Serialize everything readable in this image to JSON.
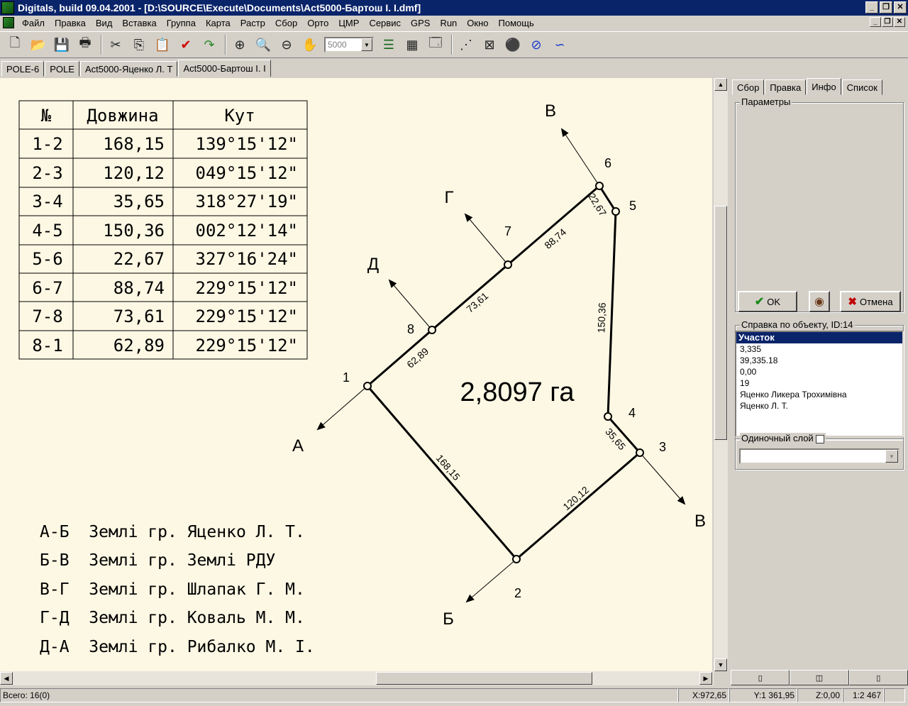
{
  "window": {
    "title": "Digitals, build 09.04.2001 - [D:\\SOURCE\\Execute\\Documents\\Act5000-Бартош І. І.dmf]",
    "min": "_",
    "max": "❐",
    "close": "✕"
  },
  "menu": [
    "Файл",
    "Правка",
    "Вид",
    "Вставка",
    "Группа",
    "Карта",
    "Растр",
    "Сбор",
    "Орто",
    "ЦМР",
    "Сервис",
    "GPS",
    "Run",
    "Окно",
    "Помощь"
  ],
  "toolbar": {
    "zoom_value": "5000",
    "icons": [
      "new-icon",
      "open-icon",
      "save-icon",
      "print-icon",
      "cut-icon",
      "copy-icon",
      "paste-icon",
      "check-icon",
      "redo-icon",
      "zoom-region-icon",
      "zoom-in-icon",
      "zoom-out-icon",
      "pan-hand-icon",
      "layers-icon",
      "table-icon",
      "properties-icon",
      "vectorize-icon",
      "clear-icon",
      "traffic-icon",
      "no-tools-icon",
      "curve-icon"
    ]
  },
  "doc_tabs": [
    "POLE-6",
    "POLE",
    "Act5000-Яценко Л. Т",
    "Act5000-Бартош І. І"
  ],
  "table": {
    "headers": [
      "№",
      "Довжина",
      "Кут"
    ],
    "rows": [
      [
        "1-2",
        "168,15",
        "139°15'12\""
      ],
      [
        "2-3",
        "120,12",
        "049°15'12\""
      ],
      [
        "3-4",
        "35,65",
        "318°27'19\""
      ],
      [
        "4-5",
        "150,36",
        "002°12'14\""
      ],
      [
        "5-6",
        "22,67",
        "327°16'24\""
      ],
      [
        "6-7",
        "88,74",
        "229°15'12\""
      ],
      [
        "7-8",
        "73,61",
        "229°15'12\""
      ],
      [
        "8-1",
        "62,89",
        "229°15'12\""
      ]
    ]
  },
  "plot": {
    "area": "2,8097 га",
    "points": [
      "1",
      "2",
      "3",
      "4",
      "5",
      "6",
      "7",
      "8"
    ],
    "edge_labels": [
      "62,89",
      "168,15",
      "120,12",
      "35,65",
      "150,36",
      "22,67",
      "88,74",
      "73,61"
    ],
    "directions": [
      "А",
      "Б",
      "В",
      "В",
      "Г",
      "Д"
    ]
  },
  "neighbours": [
    "А-Б  Землі гр. Яценко Л. Т.",
    "Б-В  Землі гр. Землі РДУ",
    "В-Г  Землі гр. Шлапак Г. М.",
    "Г-Д  Землі гр. Коваль М. М.",
    "Д-А  Землі гр. Рибалко М. І."
  ],
  "panel": {
    "tabs": [
      "Сбор",
      "Правка",
      "Инфо",
      "Список"
    ],
    "params_legend": "Параметры",
    "ok_label": "OK",
    "cancel_label": "Отмена",
    "info_legend": "Справка по объекту, ID:14",
    "info_title": "Участок",
    "info_rows": [
      "3,335",
      "39,335.18",
      "0,00",
      "19",
      "Яценко Ликера Трохимівна",
      "Яценко Л. Т."
    ],
    "single_layer": "Одиночный слой"
  },
  "status": {
    "total": "Всего: 16(0)",
    "x": "X:972,65",
    "y": "Y:1 361,95",
    "z": "Z:0,00",
    "scale": "1:2 467"
  }
}
